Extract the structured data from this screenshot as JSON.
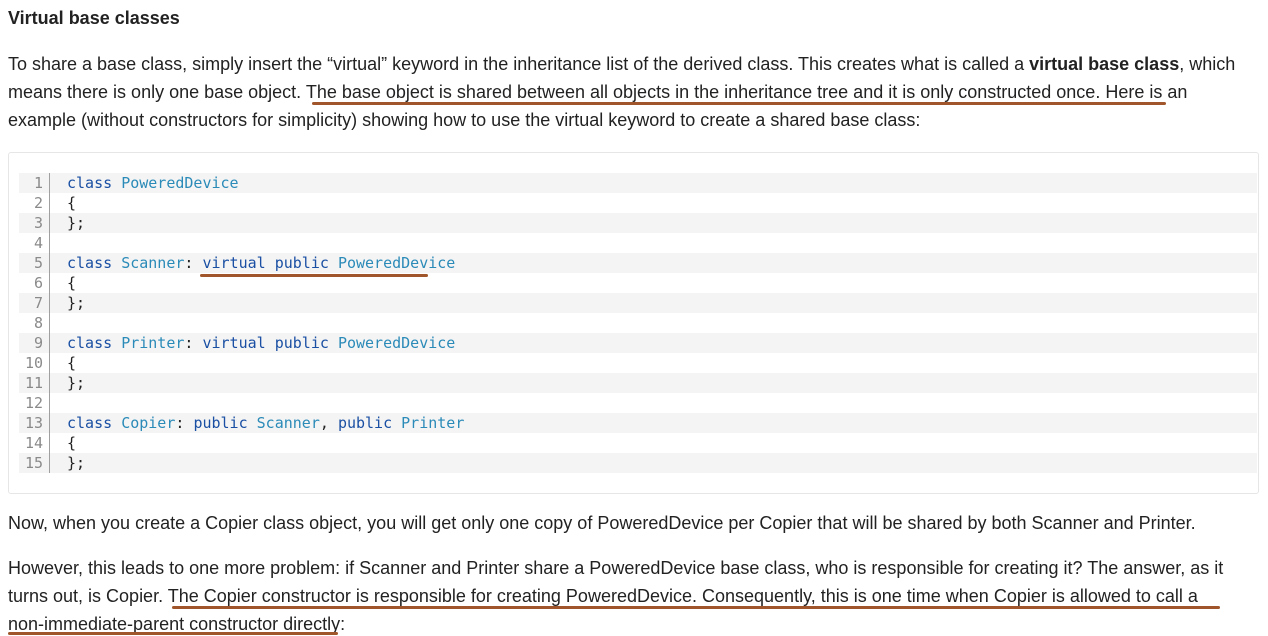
{
  "heading": "Virtual base classes",
  "para1": {
    "line1_a": "To share a base class, simply insert the “virtual” keyword in the inheritance list of the derived class. This creates what is called a ",
    "line1_bold": "virtual base class",
    "line1_b": ", which",
    "line2": "means there is only one base object. The base object is shared between all objects in the inheritance tree and it is only constructed once. Here is an",
    "line3": "example (without constructors for simplicity) showing how to use the virtual keyword to create a shared base class:"
  },
  "code": {
    "lines": [
      {
        "n": "1",
        "tokens": [
          [
            "kw",
            "class "
          ],
          [
            "cls",
            "PoweredDevice"
          ]
        ]
      },
      {
        "n": "2",
        "tokens": [
          [
            "pun",
            "{"
          ]
        ]
      },
      {
        "n": "3",
        "tokens": [
          [
            "pun",
            "};"
          ]
        ]
      },
      {
        "n": "4",
        "tokens": []
      },
      {
        "n": "5",
        "tokens": [
          [
            "kw",
            "class "
          ],
          [
            "cls",
            "Scanner"
          ],
          [
            "pun",
            ": "
          ],
          [
            "kw",
            "virtual public "
          ],
          [
            "cls",
            "PoweredDevice"
          ]
        ]
      },
      {
        "n": "6",
        "tokens": [
          [
            "pun",
            "{"
          ]
        ]
      },
      {
        "n": "7",
        "tokens": [
          [
            "pun",
            "};"
          ]
        ]
      },
      {
        "n": "8",
        "tokens": []
      },
      {
        "n": "9",
        "tokens": [
          [
            "kw",
            "class "
          ],
          [
            "cls",
            "Printer"
          ],
          [
            "pun",
            ": "
          ],
          [
            "kw",
            "virtual public "
          ],
          [
            "cls",
            "PoweredDevice"
          ]
        ]
      },
      {
        "n": "10",
        "tokens": [
          [
            "pun",
            "{"
          ]
        ]
      },
      {
        "n": "11",
        "tokens": [
          [
            "pun",
            "};"
          ]
        ]
      },
      {
        "n": "12",
        "tokens": []
      },
      {
        "n": "13",
        "tokens": [
          [
            "kw",
            "class "
          ],
          [
            "cls",
            "Copier"
          ],
          [
            "pun",
            ": "
          ],
          [
            "kw",
            "public "
          ],
          [
            "cls",
            "Scanner"
          ],
          [
            "pun",
            ", "
          ],
          [
            "kw",
            "public "
          ],
          [
            "cls",
            "Printer"
          ]
        ]
      },
      {
        "n": "14",
        "tokens": [
          [
            "pun",
            "{"
          ]
        ]
      },
      {
        "n": "15",
        "tokens": [
          [
            "pun",
            "};"
          ]
        ]
      }
    ]
  },
  "para2": "Now, when you create a Copier class object, you will get only one copy of PoweredDevice per Copier that will be shared by both Scanner and Printer.",
  "para3": {
    "line1": "However, this leads to one more problem: if Scanner and Printer share a PoweredDevice base class, who is responsible for creating it? The answer, as it",
    "line2": "turns out, is Copier. The Copier constructor is responsible for creating PoweredDevice. Consequently, this is one time when Copier is allowed to call a",
    "line3": "non-immediate-parent constructor directly:"
  },
  "colors": {
    "keyword": "#1a4fa3",
    "class_name": "#2a8ab8",
    "annotation_underline": "#a0562a"
  }
}
